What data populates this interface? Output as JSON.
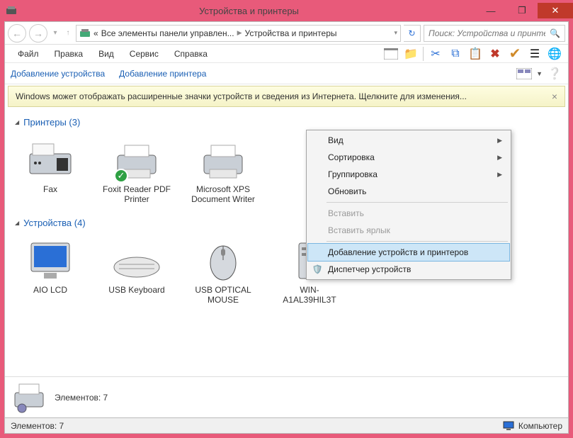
{
  "title": "Устройства и принтеры",
  "window_buttons": {
    "min": "—",
    "max": "❐",
    "close": "✕"
  },
  "breadcrumb": {
    "prefix": "«",
    "parts": [
      "Все элементы панели управлен...",
      "Устройства и принтеры"
    ]
  },
  "search": {
    "placeholder": "Поиск: Устройства и принте..."
  },
  "menubar": [
    "Файл",
    "Правка",
    "Вид",
    "Сервис",
    "Справка"
  ],
  "commands": {
    "add_device": "Добавление устройства",
    "add_printer": "Добавление принтера"
  },
  "infobar": "Windows может отображать расширенные значки устройств и сведения из Интернета.  Щелкните для изменения...",
  "groups": {
    "printers": {
      "header": "Принтеры (3)"
    },
    "devices": {
      "header": "Устройства (4)"
    }
  },
  "printers": [
    {
      "label": "Fax"
    },
    {
      "label": "Foxit Reader PDF Printer",
      "default": true
    },
    {
      "label": "Microsoft XPS Document Writer"
    }
  ],
  "devices": [
    {
      "label": "AIO LCD"
    },
    {
      "label": "USB Keyboard"
    },
    {
      "label": "USB OPTICAL MOUSE"
    },
    {
      "label": "WIN-A1AL39HIL3T"
    }
  ],
  "context_menu": {
    "view": "Вид",
    "sort": "Сортировка",
    "group": "Группировка",
    "refresh": "Обновить",
    "paste": "Вставить",
    "paste_shortcut": "Вставить ярлык",
    "add_dp": "Добавление устройств и принтеров",
    "devmgr": "Диспетчер устройств"
  },
  "details": {
    "count_label": "Элементов: 7"
  },
  "statusbar": {
    "left": "Элементов: 7",
    "right": "Компьютер"
  }
}
